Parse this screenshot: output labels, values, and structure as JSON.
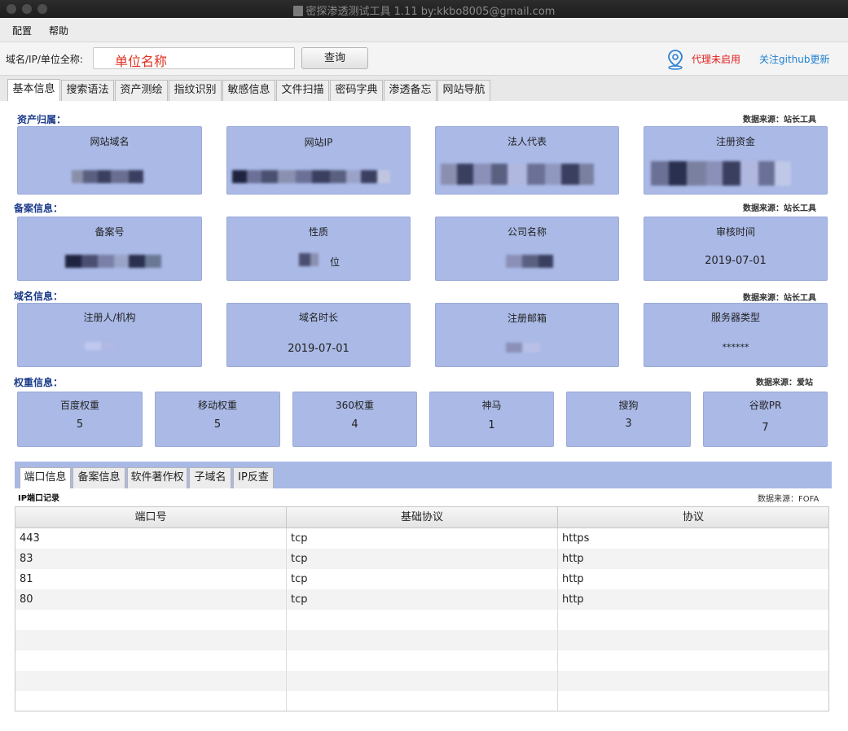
{
  "window": {
    "title": "密探渗透测试工具 1.11 by:kkbo8005@gmail.com"
  },
  "menu": {
    "items": [
      "配置",
      "帮助"
    ]
  },
  "search": {
    "label": "域名/IP/单位全称:",
    "value": "单位名称",
    "button": "查询"
  },
  "status": {
    "proxy": "代理未启用",
    "github": "关注github更新"
  },
  "tabs": [
    "基本信息",
    "搜索语法",
    "资产测绘",
    "指纹识别",
    "敏感信息",
    "文件扫描",
    "密码字典",
    "渗透备忘",
    "网站导航"
  ],
  "sections": {
    "asset": {
      "title": "资产归属：",
      "source": "数据来源：站长工具",
      "cards": [
        {
          "label": "网站域名",
          "value": ""
        },
        {
          "label": "网站IP",
          "value": ""
        },
        {
          "label": "法人代表",
          "value": ""
        },
        {
          "label": "注册资金",
          "value": ""
        }
      ]
    },
    "icp": {
      "title": "备案信息：",
      "source": "数据来源：站长工具",
      "cards": [
        {
          "label": "备案号",
          "value": ""
        },
        {
          "label": "性质",
          "value": "位"
        },
        {
          "label": "公司名称",
          "value": ""
        },
        {
          "label": "审核时间",
          "value": "2019-07-01"
        }
      ]
    },
    "domain": {
      "title": "域名信息：",
      "source": "数据来源：站长工具",
      "cards": [
        {
          "label": "注册人/机构",
          "value": ""
        },
        {
          "label": "域名时长",
          "value": "2019-07-01"
        },
        {
          "label": "注册邮箱",
          "value": ""
        },
        {
          "label": "服务器类型",
          "value": "******"
        }
      ]
    },
    "weight": {
      "title": "权重信息：",
      "source": "数据来源：爱站",
      "cards": [
        {
          "label": "百度权重",
          "value": "5"
        },
        {
          "label": "移动权重",
          "value": "5"
        },
        {
          "label": "360权重",
          "value": "4"
        },
        {
          "label": "神马",
          "value": "1"
        },
        {
          "label": "搜狗",
          "value": "3"
        },
        {
          "label": "谷歌PR",
          "value": "7"
        }
      ]
    }
  },
  "subtabs": [
    "端口信息",
    "备案信息",
    "软件著作权",
    "子域名",
    "IP反查"
  ],
  "port_table": {
    "title": "IP端口记录",
    "source": "数据来源：FOFA",
    "columns": [
      "端口号",
      "基础协议",
      "协议"
    ],
    "rows": [
      [
        "443",
        "tcp",
        "https"
      ],
      [
        "83",
        "tcp",
        "http"
      ],
      [
        "81",
        "tcp",
        "http"
      ],
      [
        "80",
        "tcp",
        "http"
      ]
    ]
  }
}
